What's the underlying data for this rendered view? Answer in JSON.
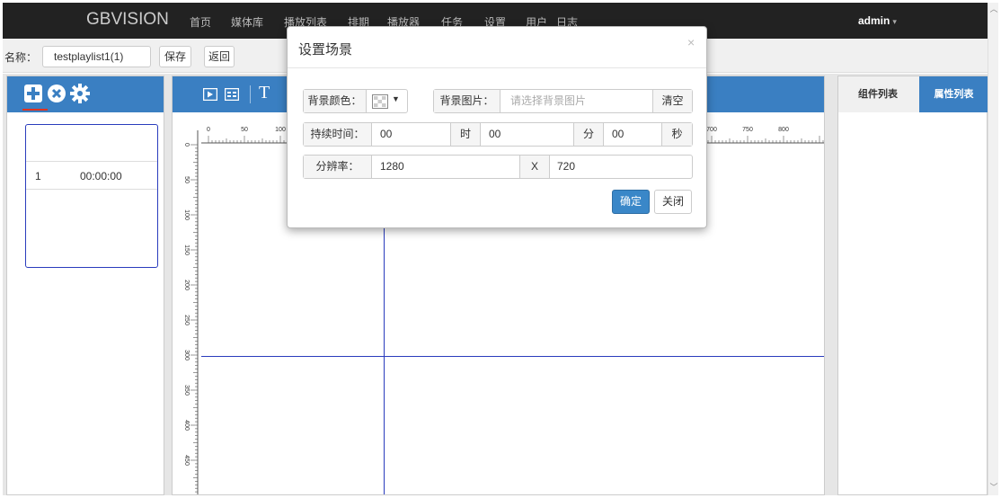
{
  "navbar": {
    "brand": "GBVISION",
    "items": [
      "首页",
      "媒体库",
      "播放列表",
      "排期",
      "播放器",
      "任务",
      "设置",
      "用户",
      "日志"
    ],
    "user": "admin"
  },
  "name_row": {
    "label": "名称：",
    "playlist_name": "testplaylist1(1)",
    "save": "保存",
    "back": "返回"
  },
  "scene_list": {
    "items": [
      {
        "index": "1",
        "duration": "00:00:00"
      }
    ]
  },
  "ruler": {
    "top": [
      "0",
      "50",
      "100",
      "700",
      "750",
      "800"
    ],
    "left": [
      "0",
      "50",
      "100",
      "150",
      "200",
      "250",
      "300",
      "350",
      "400",
      "450"
    ]
  },
  "right_tabs": [
    "组件列表",
    "属性列表"
  ],
  "modal": {
    "title": "设置场景",
    "close_glyph": "×",
    "bg_color_label": "背景颜色：",
    "bg_image_label": "背景图片：",
    "bg_image_placeholder": "请选择背景图片",
    "clear": "清空",
    "duration_label": "持续时间：",
    "hours": "00",
    "hours_unit": "时",
    "minutes": "00",
    "minutes_unit": "分",
    "seconds": "00",
    "seconds_unit": "秒",
    "resolution_label": "分辨率：",
    "width": "1280",
    "times": "X",
    "height": "720",
    "ok": "确定",
    "close": "关闭"
  },
  "colors": {
    "accent": "#3a7fc2",
    "navbar": "#222222",
    "guide": "#2a3cbd",
    "ok_button": "#3a87c8"
  }
}
